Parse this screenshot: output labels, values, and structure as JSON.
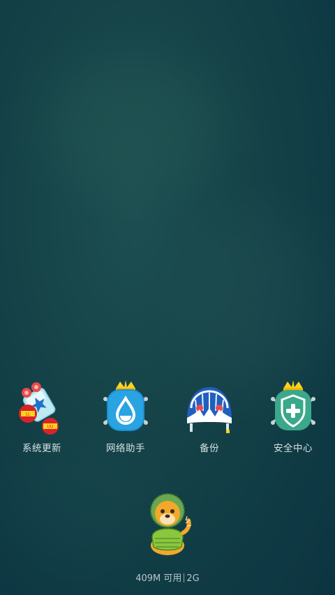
{
  "apps": [
    {
      "label": "系统更新",
      "icon": "rocket-boosters-icon"
    },
    {
      "label": "网络助手",
      "icon": "water-drop-icon"
    },
    {
      "label": "备份",
      "icon": "helmet-icon"
    },
    {
      "label": "安全中心",
      "icon": "shield-plus-icon"
    }
  ],
  "memory": {
    "used": "409M",
    "available_label": "可用",
    "total": "2G"
  },
  "colors": {
    "background": "#12404a",
    "label_text": "#d5e2e2",
    "accent_blue": "#29a3e2",
    "accent_green": "#3aa88a",
    "crown_yellow": "#ffd21f"
  }
}
